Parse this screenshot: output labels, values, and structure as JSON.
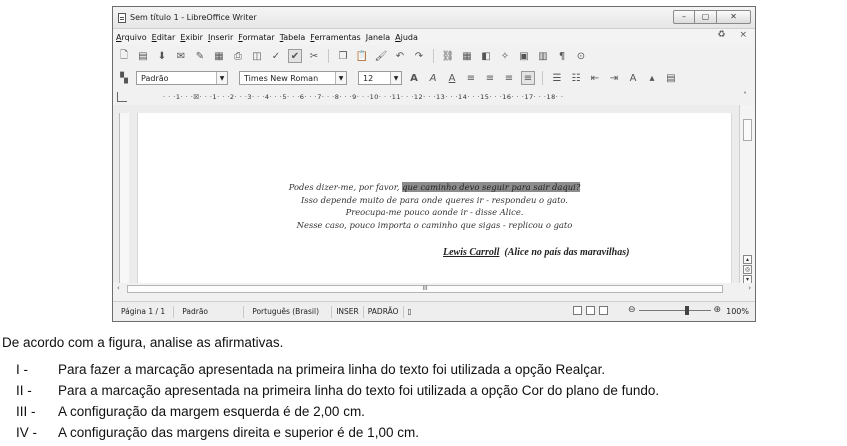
{
  "window": {
    "title": "Sem título 1 - LibreOffice Writer",
    "controls": [
      "–",
      "▢",
      "✕"
    ]
  },
  "menu": {
    "items": [
      "Arquivo",
      "Editar",
      "Exibir",
      "Inserir",
      "Formatar",
      "Tabela",
      "Ferramentas",
      "Janela",
      "Ajuda"
    ],
    "right_icons": [
      "♻",
      "×"
    ]
  },
  "format_bar": {
    "style_value": "Padrão",
    "font_value": "Times New Roman",
    "size_value": "12"
  },
  "ruler": {
    "scale": "· · ·1· · ·☒· · ·1· · ·2· · ·3· · ·4· · ·5· · ·6· · ·7· · ·8· · ·9· · ·10· · ·11· · ·12· · ·13· · ·14· · ·15· · ·16· · ·17· · ·18· ·"
  },
  "document": {
    "line1_plain": "Podes dizer-me, por favor, ",
    "line1_highlight": "que caminho devo seguir para sair daqui?",
    "line2": "Isso depende muito de para onde queres ir - respondeu o gato.",
    "line3": "Preocupa-me pouco aonde ir - disse Alice.",
    "line4": "Nesse caso, pouco importa o caminho que sigas - replicou o gato",
    "author": "Lewis Carroll",
    "work": "(Alice no país das maravilhas)"
  },
  "hscroll_label": "III",
  "status": {
    "page": "Página 1 / 1",
    "style": "Padrão",
    "language": "Português (Brasil)",
    "insert_mode": "INSER",
    "selection_mode": "PADRÃO",
    "zoom_percent": "100%"
  },
  "question": {
    "prompt": "De acordo com a figura, analise as afirmativas.",
    "statements": [
      {
        "num": "I -",
        "text": "Para fazer a marcação apresentada na primeira linha do texto foi utilizada a opção Realçar."
      },
      {
        "num": "II -",
        "text": "Para a marcação apresentada na primeira linha do texto foi utilizada a opção Cor do plano de fundo."
      },
      {
        "num": "III -",
        "text": "A configuração da margem esquerda é de 2,00 cm."
      },
      {
        "num": "IV -",
        "text": "A configuração das margens direita e superior é de 1,00 cm."
      }
    ]
  }
}
